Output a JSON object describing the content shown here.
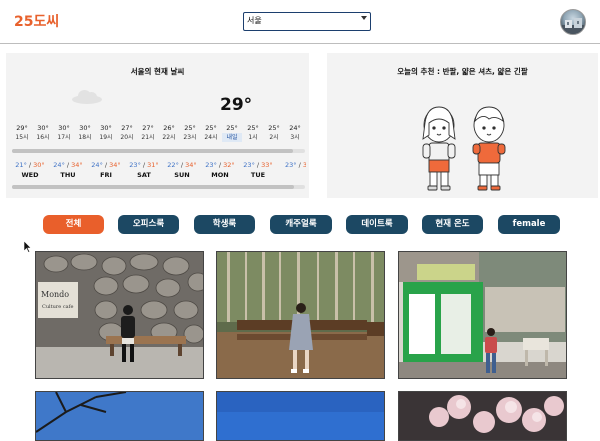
{
  "header": {
    "logo": "25도씨",
    "city_select": {
      "value": "서울"
    }
  },
  "weather": {
    "title": "서울의 현재 날씨",
    "icon": "cloud-icon",
    "current_temp": "29°",
    "hourly": [
      {
        "temp": "29°",
        "hour": "15시"
      },
      {
        "temp": "30°",
        "hour": "16시"
      },
      {
        "temp": "30°",
        "hour": "17시"
      },
      {
        "temp": "30°",
        "hour": "18시"
      },
      {
        "temp": "30°",
        "hour": "19시"
      },
      {
        "temp": "27°",
        "hour": "20시"
      },
      {
        "temp": "27°",
        "hour": "21시"
      },
      {
        "temp": "26°",
        "hour": "22시"
      },
      {
        "temp": "25°",
        "hour": "23시"
      },
      {
        "temp": "25°",
        "hour": "24시"
      },
      {
        "temp": "25°",
        "hour": "내일"
      },
      {
        "temp": "25°",
        "hour": "1시"
      },
      {
        "temp": "25°",
        "hour": "2시"
      },
      {
        "temp": "24°",
        "hour": "3시"
      }
    ],
    "daily": [
      {
        "low": "21°",
        "high": "30°",
        "day": "WED"
      },
      {
        "low": "24°",
        "high": "34°",
        "day": "THU"
      },
      {
        "low": "24°",
        "high": "34°",
        "day": "FRI"
      },
      {
        "low": "23°",
        "high": "31°",
        "day": "SAT"
      },
      {
        "low": "22°",
        "high": "34°",
        "day": "SUN"
      },
      {
        "low": "23°",
        "high": "32°",
        "day": "MON"
      },
      {
        "low": "23°",
        "high": "33°",
        "day": "TUE"
      },
      {
        "low": "23°",
        "high": "3",
        "day": ""
      }
    ]
  },
  "recommendation": {
    "title": "오늘의 추천 : 반팔, 얇은 셔츠, 얇은 긴팔"
  },
  "filters": [
    {
      "label": "전체",
      "active": true
    },
    {
      "label": "오피스룩",
      "active": false
    },
    {
      "label": "학생룩",
      "active": false
    },
    {
      "label": "캐주얼룩",
      "active": false
    },
    {
      "label": "데이트룩",
      "active": false
    },
    {
      "label": "현재 온도",
      "active": false
    },
    {
      "label": "female",
      "active": false
    }
  ],
  "photos": [
    {
      "name": "outfit-photo-stone-wall-bench"
    },
    {
      "name": "outfit-photo-forest-bench"
    },
    {
      "name": "outfit-photo-green-cafe"
    },
    {
      "name": "outfit-photo-sky-tree"
    },
    {
      "name": "outfit-photo-blue-sky"
    },
    {
      "name": "outfit-photo-blossom-night"
    }
  ],
  "colors": {
    "accent": "#e8612c",
    "chip": "#1c4863",
    "panel": "#f3f3f3",
    "low_temp": "#3e72c6",
    "high_temp": "#e8612c"
  }
}
